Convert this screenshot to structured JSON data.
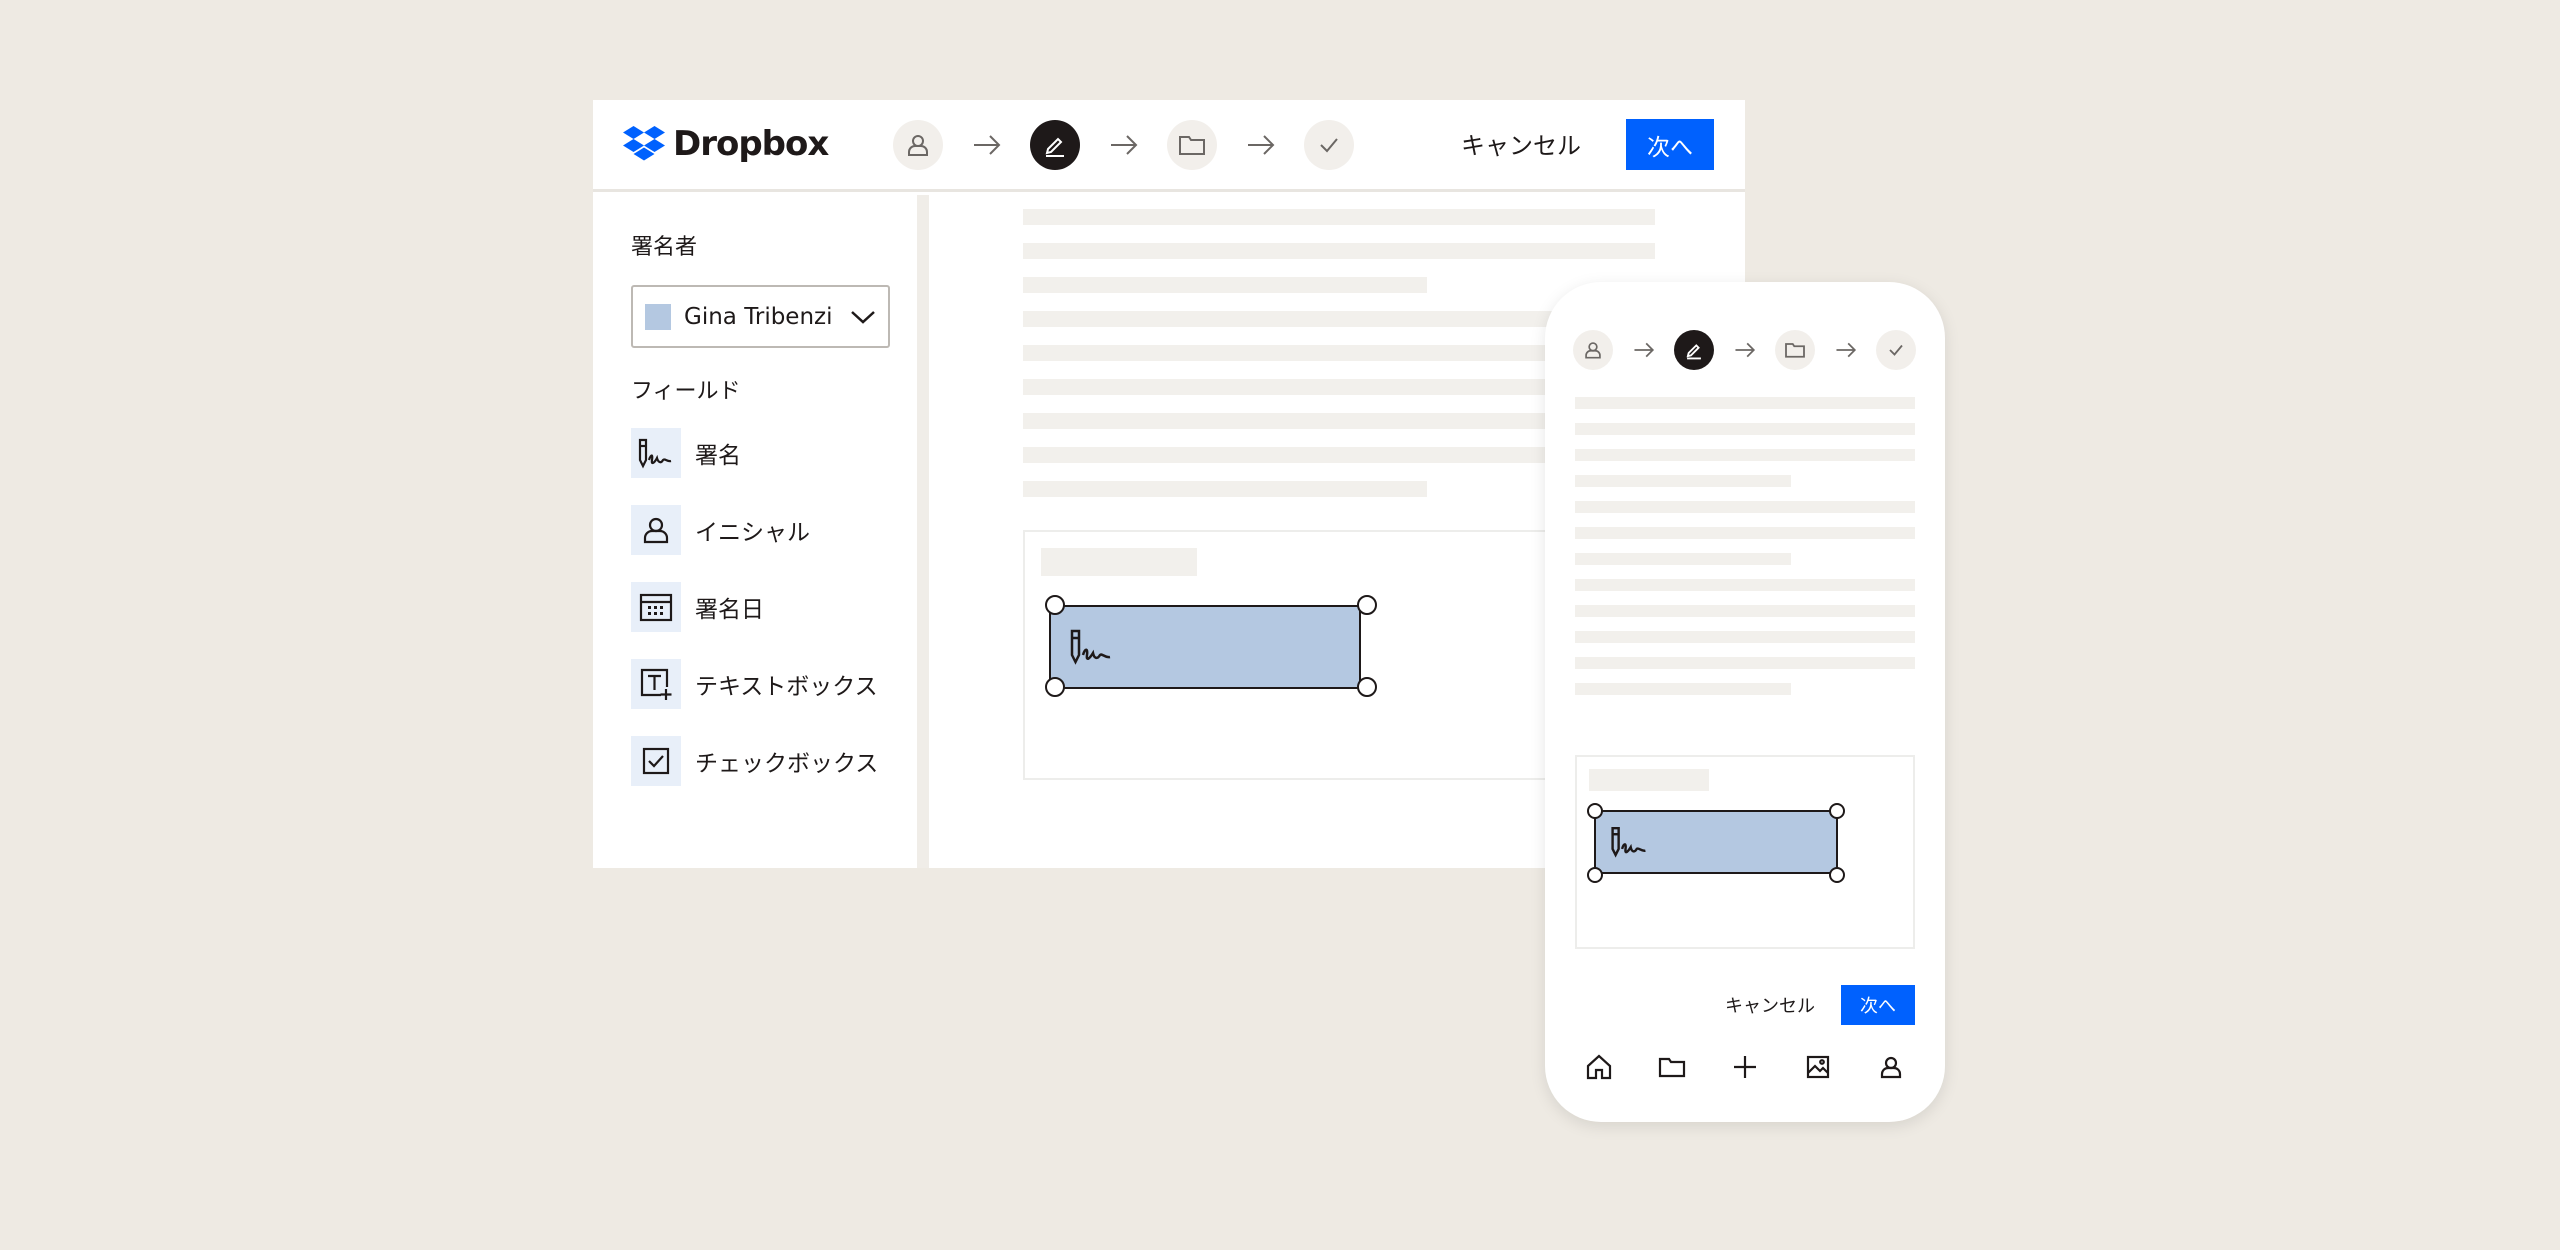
{
  "desktop": {
    "brand": "Dropbox",
    "steps": [
      {
        "icon": "person-icon",
        "active": false
      },
      {
        "icon": "pen-icon",
        "active": true
      },
      {
        "icon": "folder-icon",
        "active": false
      },
      {
        "icon": "check-icon",
        "active": false
      }
    ],
    "cancel_label": "キャンセル",
    "next_label": "次へ",
    "sidebar": {
      "signers_heading": "署名者",
      "selected_signer": "Gina Tribenzi",
      "signer_color": "#b4c8e1",
      "fields_heading": "フィールド",
      "fields": [
        {
          "label": "署名",
          "icon": "signature-icon"
        },
        {
          "label": "イニシャル",
          "icon": "person-icon"
        },
        {
          "label": "署名日",
          "icon": "calendar-icon"
        },
        {
          "label": "テキストボックス",
          "icon": "textbox-icon"
        },
        {
          "label": "チェックボックス",
          "icon": "checkbox-icon"
        }
      ]
    }
  },
  "mobile": {
    "cancel_label": "キャンセル",
    "next_label": "次へ",
    "nav": [
      "home-icon",
      "folder-icon",
      "plus-icon",
      "photos-icon",
      "person-icon"
    ]
  },
  "colors": {
    "accent": "#0061fe",
    "background": "#eeeae3",
    "signature_field": "#b4c8e1"
  }
}
